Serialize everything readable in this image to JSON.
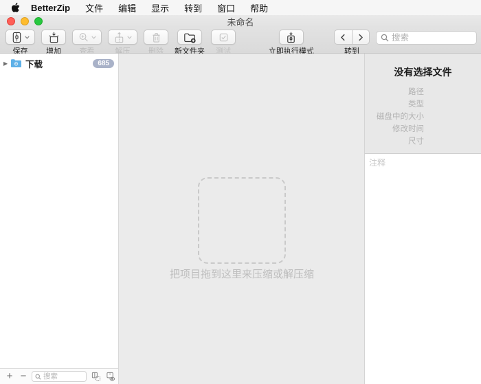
{
  "menu_bar": {
    "app_name": "BetterZip",
    "items": [
      "文件",
      "编辑",
      "显示",
      "转到",
      "窗口",
      "帮助"
    ]
  },
  "window": {
    "title": "未命名"
  },
  "toolbar": {
    "buttons": [
      {
        "label": "保存",
        "enabled": true,
        "icon": "zip-archive-icon",
        "has_dropdown": true
      },
      {
        "label": "增加",
        "enabled": true,
        "icon": "add-to-archive-icon",
        "has_dropdown": false
      },
      {
        "label": "查看",
        "enabled": false,
        "icon": "magnifier-document-icon",
        "has_dropdown": true
      },
      {
        "label": "解压",
        "enabled": false,
        "icon": "extract-archive-icon",
        "has_dropdown": true
      },
      {
        "label": "删除",
        "enabled": false,
        "icon": "trash-icon",
        "has_dropdown": false
      },
      {
        "label": "新文件夹",
        "enabled": true,
        "icon": "new-folder-icon",
        "has_dropdown": false
      },
      {
        "label": "测试",
        "enabled": false,
        "icon": "checkbox-icon",
        "has_dropdown": false
      }
    ],
    "immediate_mode_label": "立即执行模式",
    "goto_label": "转到",
    "search_placeholder": "搜索"
  },
  "sidebar": {
    "items": [
      {
        "label": "下载",
        "badge": "685",
        "icon": "download-folder-icon",
        "expanded": false
      }
    ],
    "bottom_bar": {
      "add_label": "+",
      "remove_label": "−",
      "search_placeholder": "搜索"
    }
  },
  "main": {
    "drop_caption": "把项目拖到这里来压缩或解压缩"
  },
  "inspector": {
    "title": "没有选择文件",
    "fields": [
      "路径",
      "类型",
      "磁盘中的大小",
      "修改时间",
      "尺寸"
    ],
    "comments_placeholder": "注释"
  },
  "colors": {
    "badge": "#a9b2c8",
    "folder_blue": "#5fb1e8",
    "traffic_red": "#ff5f57",
    "traffic_yellow": "#febc2e",
    "traffic_green": "#28c840",
    "main_background": "#ebebeb",
    "drop_border": "#c9c9c9"
  }
}
